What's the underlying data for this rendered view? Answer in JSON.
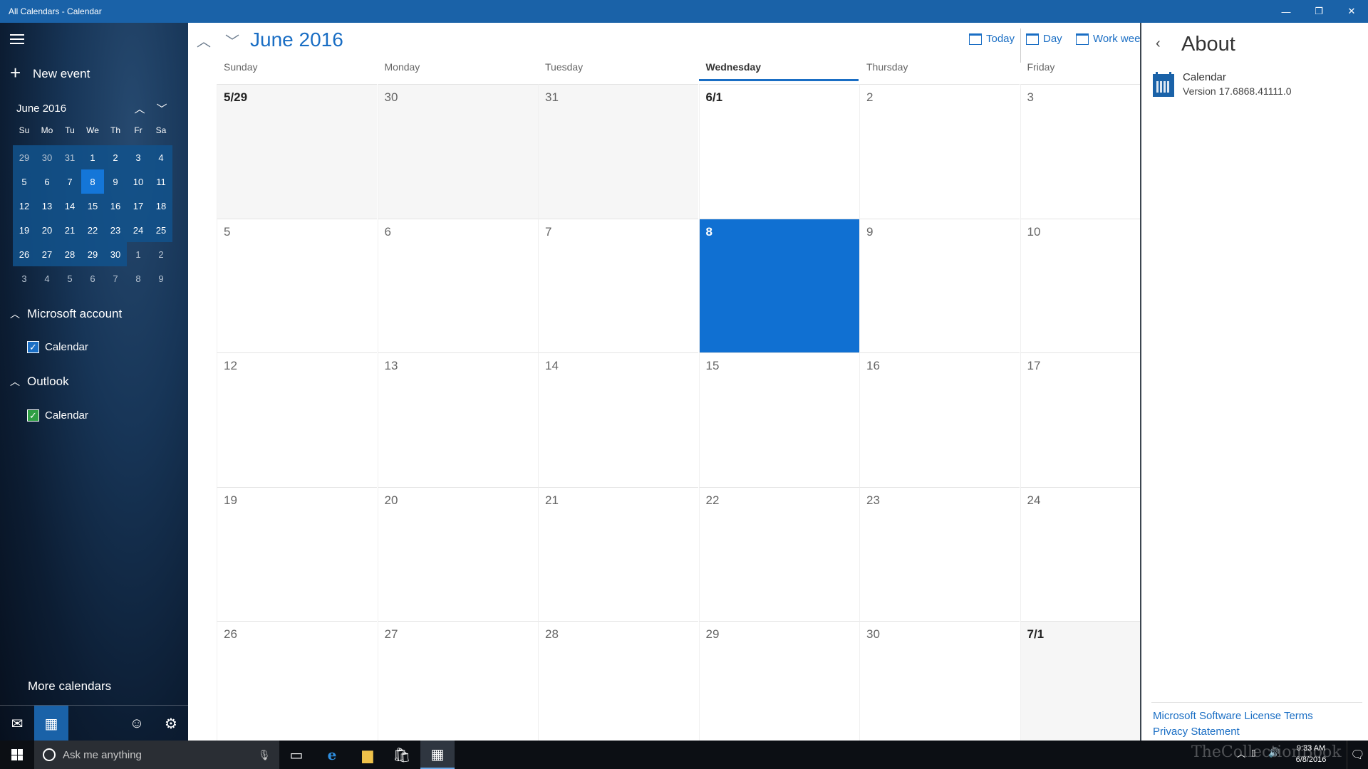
{
  "window": {
    "title": "All Calendars - Calendar",
    "minimize": "—",
    "maximize": "❐",
    "close": "✕"
  },
  "sidebar": {
    "new_event": "New event",
    "mini_calendar": {
      "month": "June 2016",
      "weekdays": [
        "Su",
        "Mo",
        "Tu",
        "We",
        "Th",
        "Fr",
        "Sa"
      ],
      "weeks": [
        [
          "29",
          "30",
          "31",
          "1",
          "2",
          "3",
          "4"
        ],
        [
          "5",
          "6",
          "7",
          "8",
          "9",
          "10",
          "11"
        ],
        [
          "12",
          "13",
          "14",
          "15",
          "16",
          "17",
          "18"
        ],
        [
          "19",
          "20",
          "21",
          "22",
          "23",
          "24",
          "25"
        ],
        [
          "26",
          "27",
          "28",
          "29",
          "30",
          "1",
          "2"
        ],
        [
          "3",
          "4",
          "5",
          "6",
          "7",
          "8",
          "9"
        ]
      ],
      "today": "8"
    },
    "accounts": [
      {
        "name": "Microsoft account",
        "calendars": [
          {
            "name": "Calendar",
            "checked": true,
            "color": "#1a6ec4"
          }
        ]
      },
      {
        "name": "Outlook",
        "calendars": [
          {
            "name": "Calendar",
            "checked": true,
            "color": "#2e9e44"
          }
        ]
      }
    ],
    "more_calendars": "More calendars"
  },
  "main": {
    "month_title": "June 2016",
    "views": [
      "Today",
      "Day",
      "Work week"
    ],
    "weekdays": [
      "Sunday",
      "Monday",
      "Tuesday",
      "Wednesday",
      "Thursday",
      "Friday"
    ],
    "selected_weekday": "Wednesday",
    "weeks": [
      [
        "5/29",
        "30",
        "31",
        "6/1",
        "2",
        "3"
      ],
      [
        "5",
        "6",
        "7",
        "8",
        "9",
        "10"
      ],
      [
        "12",
        "13",
        "14",
        "15",
        "16",
        "17"
      ],
      [
        "19",
        "20",
        "21",
        "22",
        "23",
        "24"
      ],
      [
        "26",
        "27",
        "28",
        "29",
        "30",
        "7/1"
      ]
    ],
    "today": "8"
  },
  "about": {
    "title": "About",
    "app_name": "Calendar",
    "version": "Version 17.6868.41111.0",
    "links": [
      "Microsoft Software License Terms",
      "Privacy Statement"
    ]
  },
  "taskbar": {
    "search_placeholder": "Ask me anything",
    "time": "9:33 AM",
    "date": "6/8/2016",
    "watermark": "TheCollectionBook"
  },
  "colors": {
    "accent": "#1a6ec4",
    "titlebar": "#1a62a8",
    "today": "#1070d2"
  }
}
